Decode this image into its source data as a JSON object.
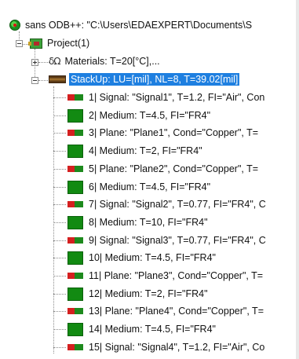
{
  "tree": {
    "root": {
      "label": "sans ODB++: \"C:\\Users\\EDAEXPERT\\Documents\\S",
      "icon": "odb-root-icon"
    },
    "project": {
      "label": "Project(1)",
      "icon": "project-icon",
      "expanded": true
    },
    "materials": {
      "label": "Materials: T=20[°C],...",
      "icon": "materials-icon",
      "expanded": false
    },
    "stackup": {
      "label": "StackUp: LU=[mil], NL=8, T=39.02[mil]",
      "icon": "stackup-icon",
      "expanded": true,
      "selected": true,
      "selected_color": "#1e7fe0"
    },
    "layers": [
      {
        "type": "signal",
        "label": "1| Signal: \"Signal1\", T=1.2, FI=\"Air\", Con"
      },
      {
        "type": "medium",
        "label": "2| Medium: T=4.5, FI=\"FR4\""
      },
      {
        "type": "plane",
        "label": "3| Plane: \"Plane1\", Cond=\"Copper\", T="
      },
      {
        "type": "medium",
        "label": "4| Medium: T=2, FI=\"FR4\""
      },
      {
        "type": "plane",
        "label": "5| Plane: \"Plane2\", Cond=\"Copper\", T="
      },
      {
        "type": "medium",
        "label": "6| Medium: T=4.5, FI=\"FR4\""
      },
      {
        "type": "signal",
        "label": "7| Signal: \"Signal2\", T=0.77, FI=\"FR4\", C"
      },
      {
        "type": "medium",
        "label": "8| Medium: T=10, FI=\"FR4\""
      },
      {
        "type": "signal",
        "label": "9| Signal: \"Signal3\", T=0.77, FI=\"FR4\", C"
      },
      {
        "type": "medium",
        "label": "10| Medium: T=4.5, FI=\"FR4\""
      },
      {
        "type": "plane",
        "label": "11| Plane: \"Plane3\", Cond=\"Copper\", T="
      },
      {
        "type": "medium",
        "label": "12| Medium: T=2, FI=\"FR4\""
      },
      {
        "type": "plane",
        "label": "13| Plane: \"Plane4\", Cond=\"Copper\", T="
      },
      {
        "type": "medium",
        "label": "14| Medium: T=4.5, FI=\"FR4\""
      },
      {
        "type": "signal",
        "label": "15| Signal: \"Signal4\", T=1.2, FI=\"Air\", Co"
      }
    ]
  },
  "colors": {
    "signal_red": "#d42020",
    "layer_green": "#128a12"
  }
}
